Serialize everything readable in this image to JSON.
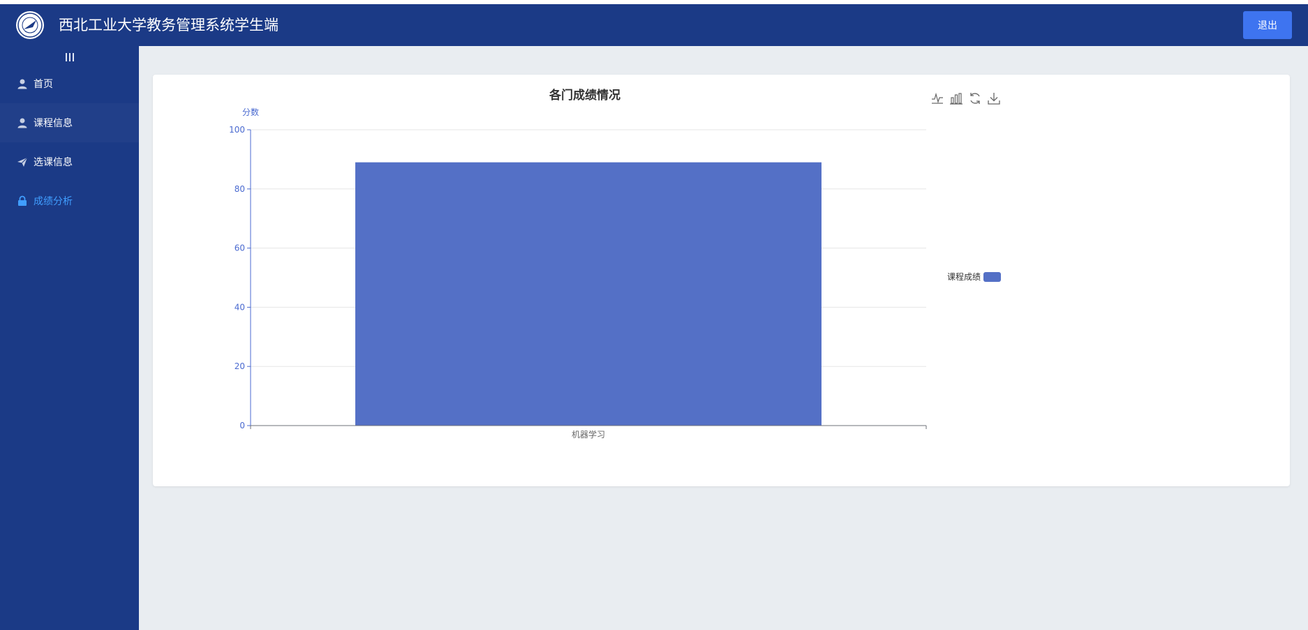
{
  "app": {
    "title": "西北工业大学教务管理系统学生端",
    "logout_label": "退出"
  },
  "sidebar": {
    "toggle_icon": "menu-bars-icon",
    "items": [
      {
        "label": "首页",
        "icon": "user-icon"
      },
      {
        "label": "课程信息",
        "icon": "user-icon"
      },
      {
        "label": "选课信息",
        "icon": "send-icon"
      },
      {
        "label": "成绩分析",
        "icon": "lock-icon",
        "active": true
      }
    ]
  },
  "colors": {
    "header_bg": "#1b3a86",
    "sidebar_bg": "#1b3a86",
    "button_bg": "#3e74f0",
    "active_menu": "#409eff",
    "bar": "#5470c6",
    "main_bg": "#e9edf1"
  },
  "toolbox": [
    "line-chart-icon",
    "bar-chart-icon",
    "refresh-icon",
    "download-icon"
  ],
  "chart_data": {
    "type": "bar",
    "title": "各门成绩情况",
    "ylabel": "分数",
    "xlabel": "",
    "categories": [
      "机器学习"
    ],
    "series": [
      {
        "name": "课程成绩",
        "values": [
          89
        ]
      }
    ],
    "ylim": [
      0,
      100
    ],
    "yticks": [
      0,
      20,
      40,
      60,
      80,
      100
    ],
    "grid": true,
    "legend_position": "right"
  }
}
